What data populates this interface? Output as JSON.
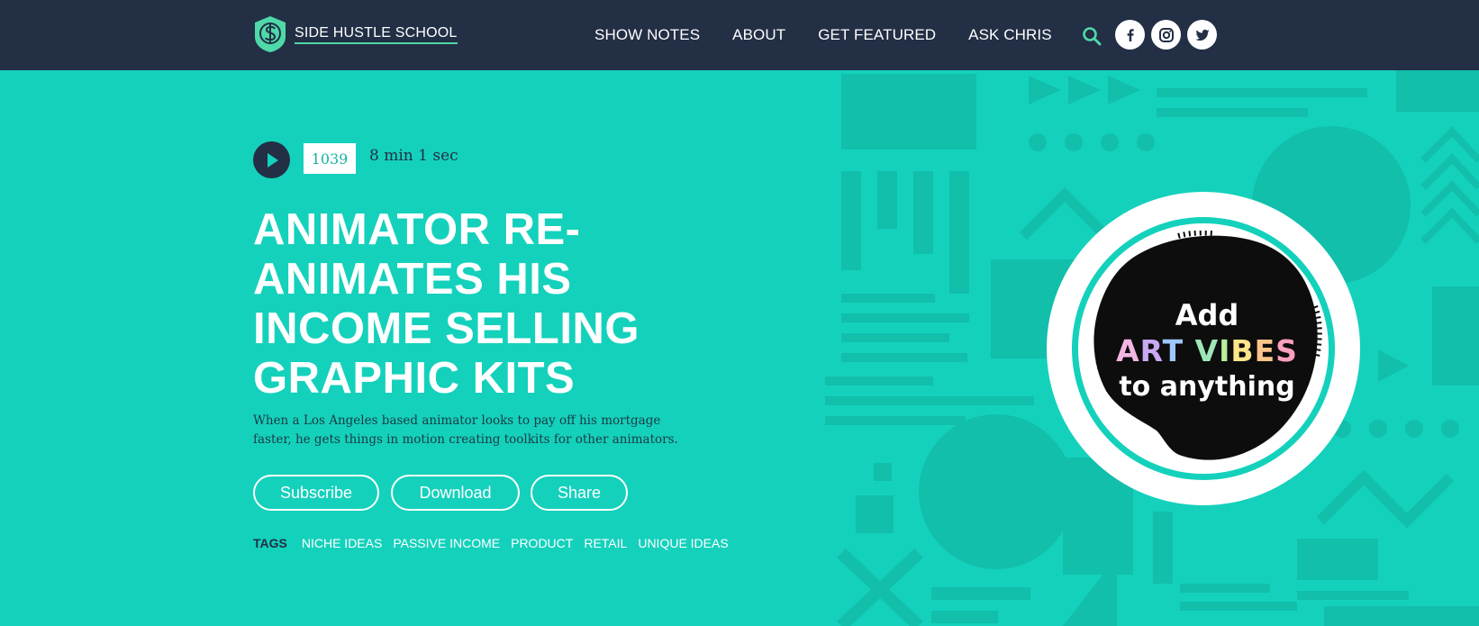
{
  "brand": {
    "name": "SIDE HUSTLE SCHOOL",
    "icon": "dollar-shield-icon",
    "accent": "#4fd8a8"
  },
  "nav": {
    "items": [
      "SHOW NOTES",
      "ABOUT",
      "GET FEATURED",
      "ASK CHRIS"
    ],
    "search_icon": "search-icon",
    "social": [
      "facebook-icon",
      "instagram-icon",
      "twitter-icon"
    ]
  },
  "episode": {
    "number": "1039",
    "duration": "8 min 1 sec",
    "title": "ANIMATOR RE-ANIMATES HIS INCOME SELLING GRAPHIC KITS",
    "description": "When a Los Angeles based animator looks to pay off his mortgage faster, he gets things in motion creating toolkits for other animators."
  },
  "actions": {
    "subscribe": "Subscribe",
    "download": "Download",
    "share": "Share"
  },
  "tags": {
    "label": "TAGS",
    "items": [
      "NICHE IDEAS",
      "PASSIVE INCOME",
      "PRODUCT",
      "RETAIL",
      "UNIQUE IDEAS"
    ]
  },
  "artwork": {
    "line1": "Add",
    "line2_letters": [
      "A",
      "R",
      "T",
      " ",
      "V",
      "I",
      "B",
      "E",
      "S"
    ],
    "line3": "to anything",
    "letter_colors": [
      "#f3b6e3",
      "#c9a8f5",
      "#9ec6ff",
      "#ffffff",
      "#9ee6b8",
      "#b9ef9c",
      "#ffe58a",
      "#ffc48a",
      "#ff9fc0"
    ]
  },
  "colors": {
    "nav_bg": "#222f45",
    "hero_bg": "#14d1bc"
  }
}
